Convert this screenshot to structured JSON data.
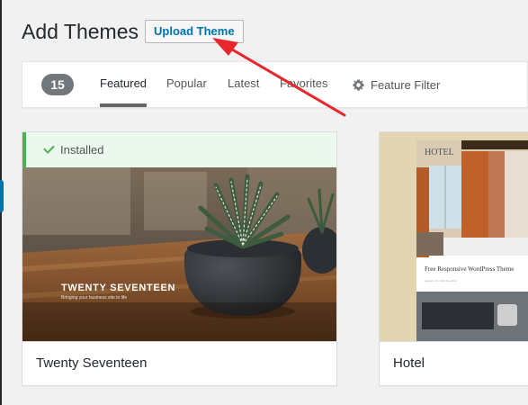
{
  "page": {
    "title": "Add Themes",
    "upload_button": "Upload Theme"
  },
  "filter_bar": {
    "count": "15",
    "tabs": [
      {
        "label": "Featured",
        "active": true
      },
      {
        "label": "Popular",
        "active": false
      },
      {
        "label": "Latest",
        "active": false
      },
      {
        "label": "Favorites",
        "active": false
      }
    ],
    "feature_filter_label": "Feature Filter",
    "feature_filter_icon": "gear-icon"
  },
  "themes": [
    {
      "name": "Twenty Seventeen",
      "installed": true,
      "installed_label": "Installed",
      "screenshot_title": "TWENTY SEVENTEEN",
      "screenshot_subtitle": "Bringing your business site to life"
    },
    {
      "name": "Hotel",
      "installed": false,
      "screenshot_logo": "HOTEL",
      "screenshot_post_title": "Free Responsive WordPress Theme",
      "screenshot_meta": "January 18, 2018 by admin"
    }
  ],
  "colors": {
    "accent": "#0073aa",
    "installed_green": "#46b450",
    "annotation_arrow": "#e8272d"
  }
}
